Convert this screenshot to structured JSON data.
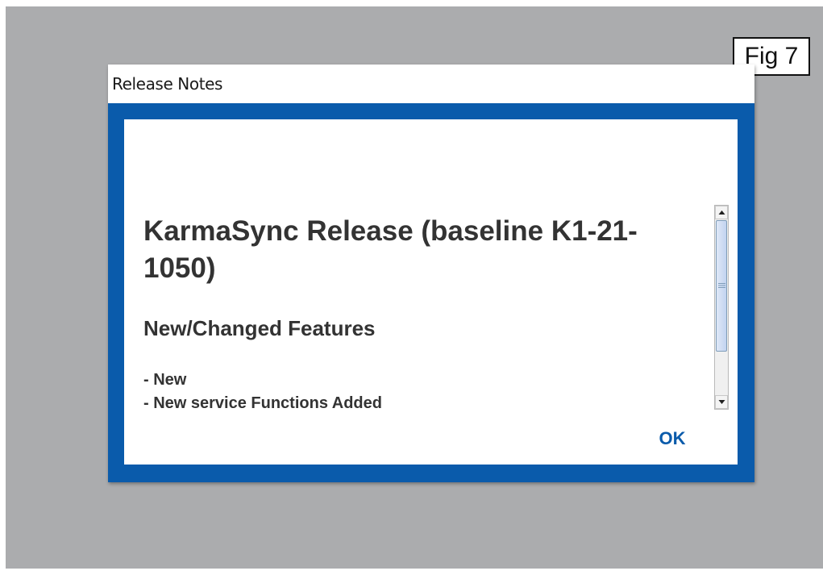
{
  "figure": {
    "label": "Fig 7"
  },
  "dialog": {
    "title": "Release Notes",
    "release_heading": "KarmaSync Release (baseline K1-21-1050)",
    "section_heading": "New/Changed Features",
    "items": [
      "- New",
      "- New service Functions Added"
    ],
    "ok_label": "OK"
  },
  "colors": {
    "frame_blue": "#0a5bab",
    "text_dark": "#333333",
    "backdrop_gray": "#abacae"
  },
  "icons": {
    "scroll_up": "arrow-up-icon",
    "scroll_down": "arrow-down-icon",
    "thumb_grip": "grip-icon"
  }
}
